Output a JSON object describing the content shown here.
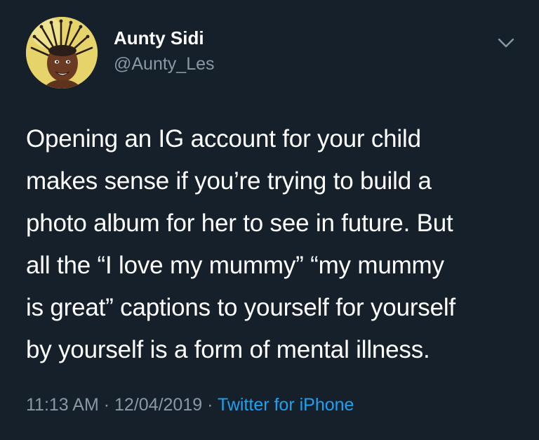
{
  "user": {
    "display_name": "Aunty Sidi",
    "handle": "@Aunty_Les",
    "avatar_icon": "profile-photo-child-with-braided-hair"
  },
  "menu": {
    "icon": "chevron-down-icon"
  },
  "tweet": {
    "lines": [
      "Opening an IG account for your child",
      "makes sense if you’re trying to build a",
      "photo album for her to see in future. But",
      "all the “I love my mummy” “my mummy",
      "is great” captions to yourself for yourself",
      "by yourself is a form of mental illness."
    ]
  },
  "meta": {
    "time": "11:13 AM",
    "separator": "·",
    "date": "12/04/2019",
    "source": "Twitter for iPhone"
  },
  "colors": {
    "background": "#15202b",
    "primary_text": "#ffffff",
    "secondary_text": "#8899a6",
    "link": "#1da1f2"
  }
}
